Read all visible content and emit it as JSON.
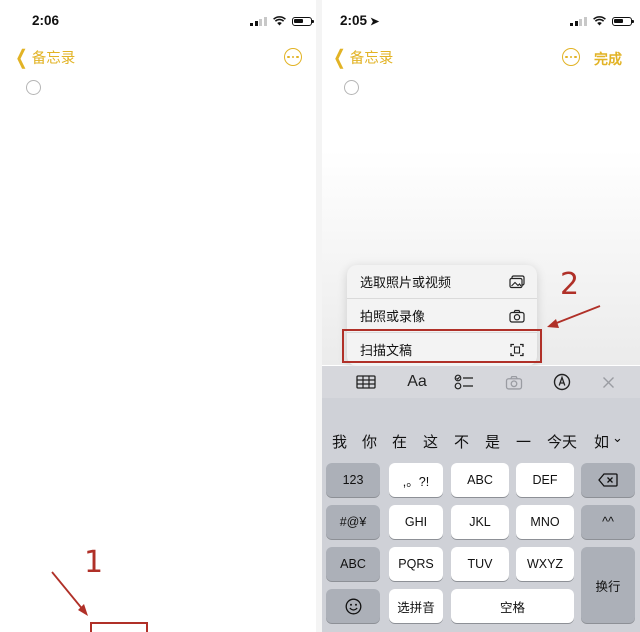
{
  "left_screen": {
    "status_time": "2:06",
    "back_label": "备忘录",
    "annotation_number": "1"
  },
  "right_screen": {
    "status_time": "2:05",
    "back_label": "备忘录",
    "done_label": "完成",
    "annotation_number": "2",
    "attachment_menu": [
      {
        "label": "选取照片或视频",
        "icon": "photo-library-icon"
      },
      {
        "label": "拍照或录像",
        "icon": "camera-icon"
      },
      {
        "label": "扫描文稿",
        "icon": "scan-document-icon"
      }
    ],
    "toolbar": {
      "format_label": "Aa",
      "icons": [
        "table-icon",
        "text-format-icon",
        "checklist-icon",
        "camera-icon",
        "markup-pen-icon",
        "close-icon"
      ]
    },
    "keyboard": {
      "candidates": [
        "我",
        "你",
        "在",
        "这",
        "不",
        "是",
        "一",
        "今天",
        "如"
      ],
      "rows": [
        [
          "123",
          ",。?!",
          "ABC",
          "DEF"
        ],
        [
          "#@¥",
          "GHI",
          "JKL",
          "MNO",
          "^^"
        ],
        [
          "ABC",
          "PQRS",
          "TUV",
          "WXYZ",
          "换行"
        ],
        [
          "选拼音",
          "空格"
        ]
      ]
    }
  },
  "colors": {
    "accent": "#e2b325",
    "annotation_red": "#b03028",
    "keyboard_bg": "#cfd1d7"
  }
}
